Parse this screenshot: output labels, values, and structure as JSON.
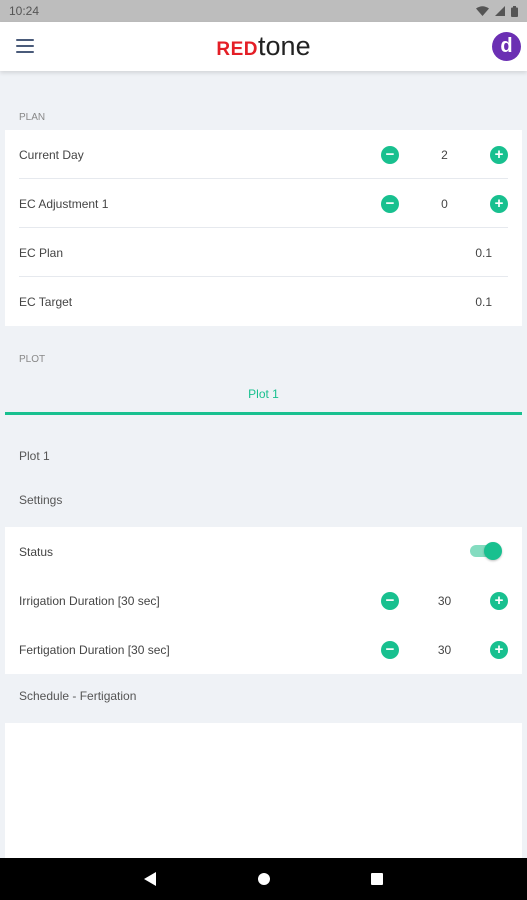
{
  "status_bar": {
    "time": "10:24",
    "wifi_icon": "wifi-icon",
    "signal_icon": "signal-icon",
    "battery_icon": "battery-icon"
  },
  "header": {
    "menu_icon": "hamburger-menu-icon",
    "logo_red": "RED",
    "logo_tone": "tone",
    "avatar_letter": "d"
  },
  "colors": {
    "accent": "#18c08f",
    "brand_red": "#e41e26",
    "avatar": "#6b2fb3",
    "background": "#eff2f6"
  },
  "plan": {
    "label": "PLAN",
    "rows": [
      {
        "label": "Current Day",
        "value": "2",
        "minus": "−",
        "plus": "+"
      },
      {
        "label": "EC Adjustment 1",
        "value": "0",
        "minus": "−",
        "plus": "+"
      },
      {
        "label": "EC Plan",
        "value": "0.1"
      },
      {
        "label": "EC Target",
        "value": "0.1"
      }
    ]
  },
  "plot": {
    "label": "PLOT",
    "tabs": [
      {
        "label": "Plot 1",
        "selected": true
      }
    ],
    "title": "Plot 1",
    "settings_label": "Settings",
    "status": {
      "label": "Status",
      "enabled": true
    },
    "rows": [
      {
        "label": "Irrigation Duration [30 sec]",
        "value": "30",
        "minus": "−",
        "plus": "+"
      },
      {
        "label": "Fertigation Duration [30 sec]",
        "value": "30",
        "minus": "−",
        "plus": "+"
      }
    ],
    "schedule_label": "Schedule - Fertigation"
  },
  "nav": {
    "back_icon": "back-icon",
    "home_icon": "home-icon",
    "recent_icon": "recent-apps-icon"
  }
}
